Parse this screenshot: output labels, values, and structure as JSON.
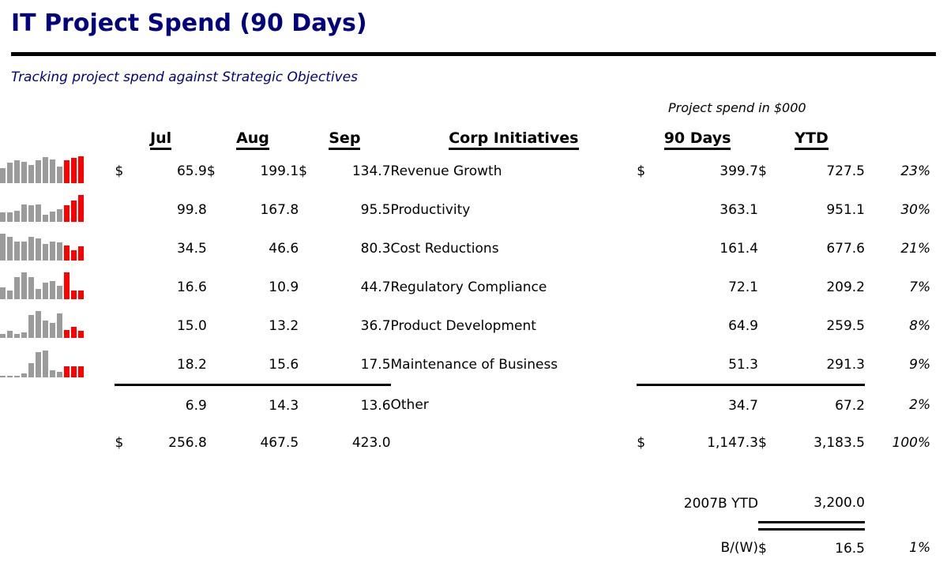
{
  "title": "IT Project Spend (90 Days)",
  "subtitle": "Tracking project spend against Strategic Objectives",
  "caption": "Project spend in $000",
  "colors": {
    "title": "#000080",
    "subtitle": "#000080",
    "spark_gray": "#9B9B9B",
    "spark_red": "#FE0000",
    "rule": "#000000"
  },
  "headers": {
    "jul": "Jul",
    "aug": "Aug",
    "sep": "Sep",
    "initiatives": "Corp Initiatives",
    "ninety": "90 Days",
    "ytd": "YTD"
  },
  "currency_symbol": "$",
  "rows": [
    {
      "initiative": "Revenue Growth",
      "jul_cur": "$",
      "jul": "65.9",
      "aug_cur": "$",
      "aug": "199.1",
      "sep_cur": "$",
      "sep": "134.7",
      "d90_cur": "$",
      "d90": "399.7",
      "ytd_cur": "$",
      "ytd": "727.5",
      "pct": "23%",
      "spark": [
        18,
        24,
        27,
        25,
        22,
        27,
        31,
        28,
        20,
        27,
        30,
        32
      ]
    },
    {
      "initiative": "Productivity",
      "jul_cur": "",
      "jul": "99.8",
      "aug_cur": "",
      "aug": "167.8",
      "sep_cur": "",
      "sep": "95.5",
      "d90_cur": "",
      "d90": "363.1",
      "ytd_cur": "",
      "ytd": "951.1",
      "pct": "30%",
      "spark": [
        12,
        12,
        14,
        21,
        20,
        21,
        9,
        13,
        16,
        20,
        26,
        33
      ]
    },
    {
      "initiative": "Cost Reductions",
      "jul_cur": "",
      "jul": "34.5",
      "aug_cur": "",
      "aug": "46.6",
      "sep_cur": "",
      "sep": "80.3",
      "d90_cur": "",
      "d90": "161.4",
      "ytd_cur": "",
      "ytd": "677.6",
      "pct": "21%",
      "spark": [
        27,
        24,
        19,
        19,
        24,
        22,
        17,
        19,
        18,
        15,
        10,
        14
      ]
    },
    {
      "initiative": "Regulatory Compliance",
      "jul_cur": "",
      "jul": "16.6",
      "aug_cur": "",
      "aug": "10.9",
      "sep_cur": "",
      "sep": "44.7",
      "d90_cur": "",
      "d90": "72.1",
      "ytd_cur": "",
      "ytd": "209.2",
      "pct": "7%",
      "spark": [
        7,
        5,
        13,
        16,
        13,
        6,
        10,
        11,
        8,
        16,
        5,
        5
      ]
    },
    {
      "initiative": "Product Development",
      "jul_cur": "",
      "jul": "15.0",
      "aug_cur": "",
      "aug": "13.2",
      "sep_cur": "",
      "sep": "36.7",
      "d90_cur": "",
      "d90": "64.9",
      "ytd_cur": "",
      "ytd": "259.5",
      "pct": "8%",
      "spark": [
        3,
        5,
        3,
        4,
        17,
        20,
        13,
        11,
        18,
        6,
        8,
        5
      ]
    },
    {
      "initiative": "Maintenance of Business",
      "jul_cur": "",
      "jul": "18.2",
      "aug_cur": "",
      "aug": "15.6",
      "sep_cur": "",
      "sep": "17.5",
      "d90_cur": "",
      "d90": "51.3",
      "ytd_cur": "",
      "ytd": "291.3",
      "pct": "9%",
      "spark": [
        1,
        1,
        1,
        2,
        8,
        14,
        15,
        4,
        3,
        6,
        6,
        6
      ]
    },
    {
      "initiative": "Other",
      "jul_cur": "",
      "jul": "6.9",
      "aug_cur": "",
      "aug": "14.3",
      "sep_cur": "",
      "sep": "13.6",
      "d90_cur": "",
      "d90": "34.7",
      "ytd_cur": "",
      "ytd": "67.2",
      "pct": "2%",
      "spark": []
    }
  ],
  "totals": {
    "jul_cur": "$",
    "jul": "256.8",
    "aug_cur": "",
    "aug": "467.5",
    "sep_cur": "",
    "sep": "423.0",
    "d90_cur": "$",
    "d90": "1,147.3",
    "ytd_cur": "$",
    "ytd": "3,183.5",
    "pct": "100%"
  },
  "budget": {
    "label": "2007B YTD",
    "value": "3,200.0"
  },
  "variance": {
    "label": "B/(W)",
    "currency": "$",
    "value": "16.5",
    "pct": "1%"
  }
}
